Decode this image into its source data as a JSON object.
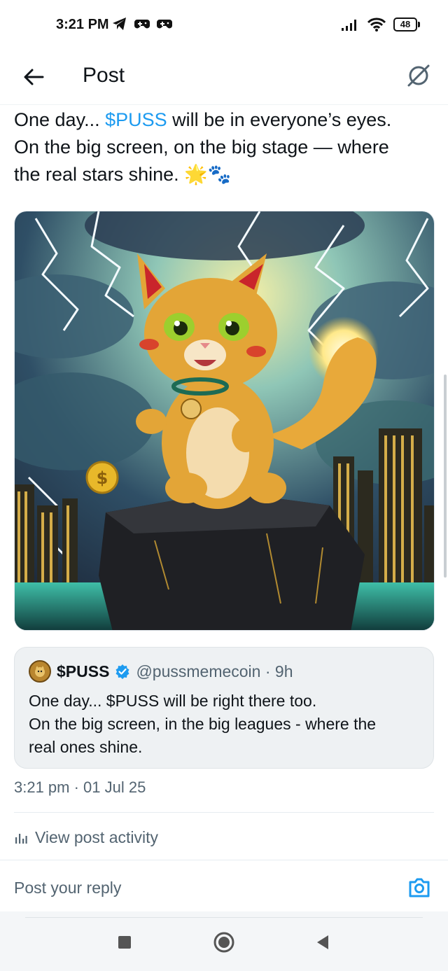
{
  "status_bar": {
    "time": "3:21 PM",
    "battery": "48",
    "icons": [
      "telegram-icon",
      "gamepad-icon",
      "gamepad-icon",
      "signal-icon",
      "wifi-icon",
      "battery-icon"
    ]
  },
  "header": {
    "title": "Post",
    "back_icon": "arrow-left-icon",
    "grok_icon": "grok-icon"
  },
  "post": {
    "text_lines": [
      [
        "One day... ",
        "$PUSS",
        " will be in everyone’s eyes."
      ],
      [
        "On the big screen, on the big stage — where"
      ],
      [
        "the real stars shine. 🌟🐾"
      ]
    ],
    "image_alt": "Cartoon orange cat standing on a rock with lightning storm and city skyline"
  },
  "quote": {
    "name": "$PUSS",
    "handle": "@pussmemecoin · 9h",
    "body_lines": [
      "One day... $PUSS will be right there too.",
      "On the big screen, in the big leagues - where the",
      "real ones shine."
    ]
  },
  "meta": {
    "timestamp": "3:21 pm · 01 Jul 25",
    "activity_label": "View post activity"
  },
  "reply": {
    "placeholder": "Post your reply"
  },
  "colors": {
    "accent": "#1d9bf0",
    "text": "#0f1419",
    "muted": "#536471"
  }
}
